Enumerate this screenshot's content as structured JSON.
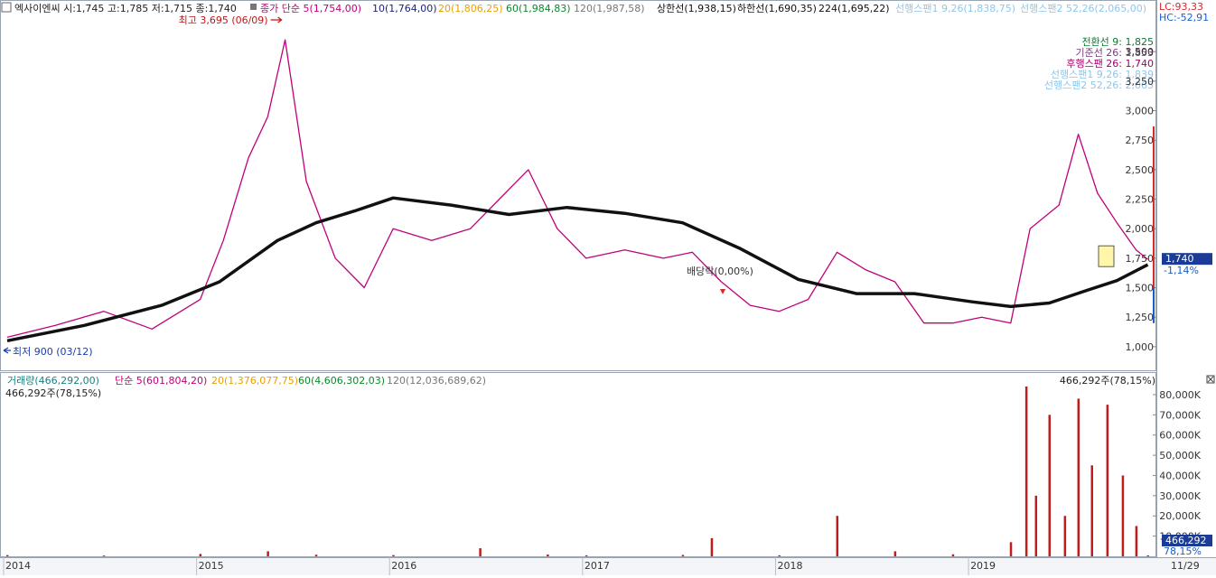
{
  "price_panel": {
    "summary": "엑사이엔씨 시:1,745 고:1,785 저:1,715 종:1,740",
    "legend": [
      {
        "text": "종가 단순 5(1,754,00)",
        "color": "#c0007a"
      },
      {
        "text": "10(1,764,00)",
        "color": "#1a237e"
      },
      {
        "text": "20(1,806,25)",
        "color": "#e8a000"
      },
      {
        "text": "60(1,984,83)",
        "color": "#0a8a2a"
      },
      {
        "text": "120(1,987,58)",
        "color": "#777777"
      },
      {
        "text": "상한선(1,938,15)",
        "color": "#111111"
      },
      {
        "text": "하한선(1,690,35)",
        "color": "#111111"
      },
      {
        "text": "224(1,695,22)",
        "color": "#111111"
      },
      {
        "text": "선행스팬1 9,26(1,838,75)",
        "color": "#8fc6ea"
      },
      {
        "text": "선행스팬2 52,26(2,065,00)",
        "color": "#8fc6ea"
      }
    ],
    "ichimoku": [
      {
        "text": "전환선 9: 1,825",
        "color": "#0a7a30"
      },
      {
        "text": "기준선 26: 1,853",
        "color": "#7a3a7a"
      },
      {
        "text": "후행스팬 26: 1,740",
        "color": "#a0006a"
      },
      {
        "text": "선행스팬1 9,26: 1,839",
        "color": "#8fc6ea"
      },
      {
        "text": "선행스팬2 52,26: 2,065",
        "color": "#8fc6ea"
      }
    ],
    "lc": "LC:93,33",
    "hc": "HC:-52,91",
    "high_marker": "최고 3,695 (06/09)",
    "low_marker": "최저 900 (03/12)",
    "dividend": "배당락(0,00%)",
    "last_price": "1,740",
    "last_change": "-1,14%"
  },
  "volume_panel": {
    "legend": [
      {
        "text": "거래량(466,292,00)",
        "color": "#1a8080"
      },
      {
        "text": "단순 5(601,804,20)",
        "color": "#c0007a"
      },
      {
        "text": "20(1,376,077,75)",
        "color": "#e8a000"
      },
      {
        "text": "60(4,606,302,03)",
        "color": "#0a8a2a"
      },
      {
        "text": "120(12,036,689,62)",
        "color": "#777777"
      }
    ],
    "current_left": "466,292주(78,15%)",
    "current_right": "466,292주(78,15%)",
    "last_volume": "466,292",
    "last_ratio": "78,15%"
  },
  "date_axis_end": "11/29",
  "chart_data": [
    {
      "type": "line",
      "title": "",
      "series_name": "엑사이엔씨",
      "x_ticks": [
        "2014",
        "2015",
        "2016",
        "2017",
        "2018",
        "2019"
      ],
      "y_ticks": [
        "1,000",
        "1,250",
        "1,500",
        "1,750",
        "2,000",
        "2,250",
        "2,500",
        "2,750",
        "3,000",
        "3,250",
        "3,500"
      ],
      "y_tick_values": [
        1000,
        1250,
        1500,
        1750,
        2000,
        2250,
        2500,
        2750,
        3000,
        3250,
        3500
      ],
      "ylim": [
        800,
        3800
      ],
      "x_range": [
        "2014-01",
        "2019-11"
      ],
      "series": [
        {
          "name": "close",
          "color": "#c0007a",
          "x": [
            2014.0,
            2014.25,
            2014.5,
            2014.75,
            2015.0,
            2015.12,
            2015.25,
            2015.35,
            2015.44,
            2015.55,
            2015.7,
            2015.85,
            2016.0,
            2016.2,
            2016.4,
            2016.55,
            2016.7,
            2016.85,
            2017.0,
            2017.2,
            2017.4,
            2017.55,
            2017.7,
            2017.85,
            2018.0,
            2018.15,
            2018.3,
            2018.45,
            2018.6,
            2018.75,
            2018.9,
            2019.05,
            2019.2,
            2019.3,
            2019.45,
            2019.55,
            2019.65,
            2019.75,
            2019.85,
            2019.91
          ],
          "y": [
            1080,
            1180,
            1300,
            1150,
            1400,
            1900,
            2600,
            2950,
            3600,
            2400,
            1750,
            1500,
            2000,
            1900,
            2000,
            2250,
            2500,
            2000,
            1750,
            1820,
            1750,
            1800,
            1550,
            1350,
            1300,
            1400,
            1800,
            1650,
            1550,
            1200,
            1200,
            1250,
            1200,
            2000,
            2200,
            2800,
            2300,
            2050,
            1820,
            1740
          ]
        },
        {
          "name": "224",
          "color": "#111111",
          "x": [
            2014.0,
            2014.4,
            2014.8,
            2015.1,
            2015.4,
            2015.6,
            2015.8,
            2016.0,
            2016.3,
            2016.6,
            2016.9,
            2017.2,
            2017.5,
            2017.8,
            2018.1,
            2018.4,
            2018.7,
            2019.0,
            2019.2,
            2019.4,
            2019.6,
            2019.75,
            2019.91
          ],
          "y": [
            1050,
            1180,
            1350,
            1550,
            1900,
            2050,
            2150,
            2260,
            2200,
            2120,
            2180,
            2130,
            2050,
            1830,
            1570,
            1450,
            1450,
            1380,
            1340,
            1370,
            1480,
            1560,
            1695
          ]
        }
      ]
    },
    {
      "type": "bar",
      "title": "",
      "series_name": "거래량",
      "y_ticks": [
        "10,000K",
        "20,000K",
        "30,000K",
        "40,000K",
        "50,000K",
        "60,000K",
        "70,000K",
        "80,000K"
      ],
      "y_tick_values": [
        10000,
        20000,
        30000,
        40000,
        50000,
        60000,
        70000,
        80000
      ],
      "ylim": [
        0,
        84000
      ],
      "units": "K",
      "x": [
        2014.0,
        2014.5,
        2015.0,
        2015.35,
        2015.6,
        2016.0,
        2016.45,
        2016.8,
        2017.0,
        2017.5,
        2017.65,
        2018.0,
        2018.3,
        2018.6,
        2018.9,
        2019.2,
        2019.28,
        2019.33,
        2019.4,
        2019.48,
        2019.55,
        2019.62,
        2019.7,
        2019.78,
        2019.85,
        2019.91
      ],
      "values": [
        600,
        400,
        1200,
        2500,
        800,
        600,
        4000,
        900,
        500,
        700,
        9000,
        500,
        20000,
        2500,
        1000,
        7000,
        84000,
        30000,
        70000,
        20000,
        78000,
        45000,
        75000,
        40000,
        15000,
        466
      ]
    }
  ]
}
